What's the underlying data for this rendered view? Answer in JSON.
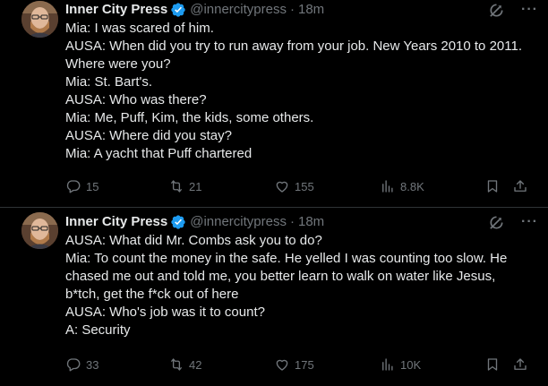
{
  "tweets": [
    {
      "author": {
        "display_name": "Inner City Press",
        "handle": "@innercitypress",
        "separator": "·",
        "time": "18m"
      },
      "lines": [
        "Mia: I was scared of him.",
        "AUSA: When did you try to run away from your job. New Years 2010 to 2011.",
        "Where were you?",
        "Mia: St. Bart's.",
        "AUSA: Who was there?",
        "Mia: Me, Puff, Kim, the kids, some others.",
        "AUSA: Where did you stay?",
        "Mia: A yacht that Puff chartered"
      ],
      "stats": {
        "replies": "15",
        "reposts": "21",
        "likes": "155",
        "views": "8.8K"
      }
    },
    {
      "author": {
        "display_name": "Inner City Press",
        "handle": "@innercitypress",
        "separator": "·",
        "time": "18m"
      },
      "lines": [
        "AUSA: What did Mr. Combs ask you to do?",
        "Mia: To count the money in the safe. He yelled I was counting too slow. He",
        "chased me out and told me, you better learn to walk on water like Jesus,",
        "b*tch, get the f*ck out of here",
        "AUSA: Who's job was it to count?",
        "A: Security"
      ],
      "stats": {
        "replies": "33",
        "reposts": "42",
        "likes": "175",
        "views": "10K"
      }
    }
  ],
  "icons": {
    "verified": "verified-badge-icon",
    "grok": "grok-icon",
    "more": "more-icon",
    "reply": "reply-icon",
    "repost": "repost-icon",
    "like": "like-icon",
    "views": "views-icon",
    "bookmark": "bookmark-icon",
    "share": "share-icon"
  },
  "colors": {
    "background": "#000000",
    "text": "#e7e9ea",
    "muted": "#71767b",
    "verified": "#1d9bf0",
    "divider": "#2f3336"
  }
}
